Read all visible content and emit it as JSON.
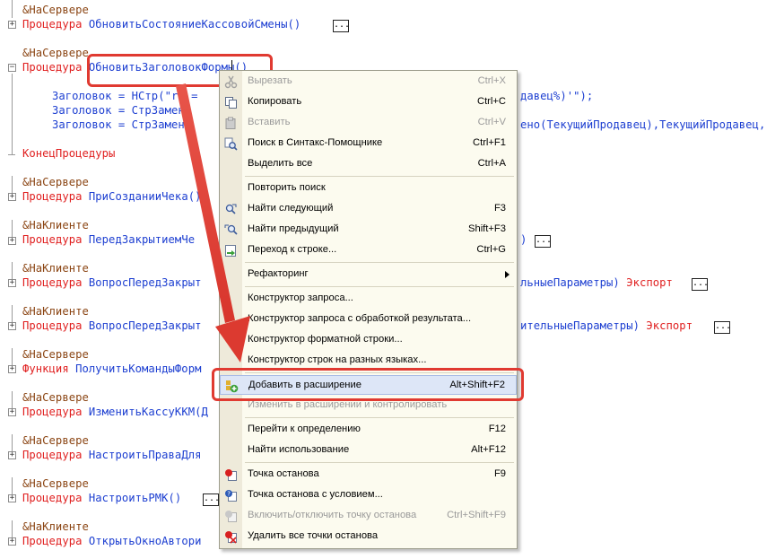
{
  "code": {
    "lines": [
      {
        "key": "l1",
        "dir": "&НаСервере"
      },
      {
        "key": "l2",
        "kw": "Процедура",
        "id": "ОбновитьСостояниеКассовойСмены()"
      },
      {
        "key": "l3",
        "dir": "&НаСервере"
      },
      {
        "key": "l4",
        "kw": "Процедура",
        "id": "ОбновитьЗаголовокФормы()"
      },
      {
        "key": "l5a",
        "text": "Заголовок = НСтр(\"ru ="
      },
      {
        "key": "l5b",
        "text": "давец%)'\");"
      },
      {
        "key": "l6a",
        "text": "Заголовок = СтрЗамени"
      },
      {
        "key": "l7a",
        "text": "Заголовок = СтрЗамени"
      },
      {
        "key": "l7b",
        "text": "ено(ТекущийПродавец),ТекущийПродавец,"
      },
      {
        "key": "l8",
        "kw": "КонецПроцедуры"
      },
      {
        "key": "l9",
        "dir": "&НаСервере"
      },
      {
        "key": "l10",
        "kw": "Процедура",
        "id": "ПриСозданииЧека()"
      },
      {
        "key": "l11",
        "dir": "&НаКлиенте"
      },
      {
        "key": "l12",
        "kw": "Процедура",
        "id": "ПередЗакрытиемЧе"
      },
      {
        "key": "l12b",
        "text": ")"
      },
      {
        "key": "l13",
        "dir": "&НаКлиенте"
      },
      {
        "key": "l14",
        "kw": "Процедура",
        "id": "ВопросПередЗакрыт"
      },
      {
        "key": "l14b",
        "text": "льныеПараметры)",
        "kw2": "Экспорт"
      },
      {
        "key": "l15",
        "dir": "&НаКлиенте"
      },
      {
        "key": "l16",
        "kw": "Процедура",
        "id": "ВопросПередЗакрыт"
      },
      {
        "key": "l16b",
        "text": "ительныеПараметры)",
        "kw2": "Экспорт"
      },
      {
        "key": "l17",
        "dir": "&НаСервере"
      },
      {
        "key": "l18",
        "kw": "Функция",
        "id": "ПолучитьКомандыФорм"
      },
      {
        "key": "l19",
        "dir": "&НаСервере"
      },
      {
        "key": "l20",
        "kw": "Процедура",
        "id": "ИзменитьКассуККМ(Д"
      },
      {
        "key": "l21",
        "dir": "&НаСервере"
      },
      {
        "key": "l22",
        "kw": "Процедура",
        "id": "НастроитьПраваДля"
      },
      {
        "key": "l23",
        "dir": "&НаСервере"
      },
      {
        "key": "l24",
        "kw": "Процедура",
        "id": "НастроитьРМК()"
      },
      {
        "key": "l25",
        "dir": "&НаКлиенте"
      },
      {
        "key": "l26",
        "kw": "Процедура",
        "id": "ОткрытьОкноАвтори"
      }
    ],
    "ellipsis": "..."
  },
  "menu": {
    "items": [
      {
        "label": "Вырезать",
        "shortcut": "Ctrl+X",
        "disabled": true,
        "icon": "scissors-icon"
      },
      {
        "label": "Копировать",
        "shortcut": "Ctrl+C",
        "disabled": false,
        "icon": "copy-icon"
      },
      {
        "label": "Вставить",
        "shortcut": "Ctrl+V",
        "disabled": true,
        "icon": "paste-icon"
      },
      {
        "label": "Поиск в Синтакс-Помощнике",
        "shortcut": "Ctrl+F1",
        "disabled": false,
        "icon": "syntax-search-icon"
      },
      {
        "label": "Выделить все",
        "shortcut": "Ctrl+A",
        "disabled": false,
        "icon": ""
      },
      {
        "label": "Повторить поиск",
        "shortcut": "",
        "disabled": false,
        "icon": ""
      },
      {
        "label": "Найти следующий",
        "shortcut": "F3",
        "disabled": false,
        "icon": "find-next-icon"
      },
      {
        "label": "Найти предыдущий",
        "shortcut": "Shift+F3",
        "disabled": false,
        "icon": "find-previous-icon"
      },
      {
        "label": "Переход к строке...",
        "shortcut": "Ctrl+G",
        "disabled": false,
        "icon": "goto-line-icon"
      },
      {
        "label": "Рефакторинг",
        "shortcut": "",
        "disabled": false,
        "icon": ""
      },
      {
        "label": "Конструктор запроса...",
        "shortcut": "",
        "disabled": false,
        "icon": ""
      },
      {
        "label": "Конструктор запроса с обработкой результата...",
        "shortcut": "",
        "disabled": false,
        "icon": ""
      },
      {
        "label": "Конструктор форматной строки...",
        "shortcut": "",
        "disabled": false,
        "icon": ""
      },
      {
        "label": "Конструктор строк на разных языках...",
        "shortcut": "",
        "disabled": false,
        "icon": ""
      },
      {
        "label": "Добавить в расширение",
        "shortcut": "Alt+Shift+F2",
        "disabled": false,
        "icon": "add-to-extension-icon"
      },
      {
        "label": "Изменить в расширении и контролировать",
        "shortcut": "",
        "disabled": true,
        "icon": ""
      },
      {
        "label": "Перейти к определению",
        "shortcut": "F12",
        "disabled": false,
        "icon": ""
      },
      {
        "label": "Найти использование",
        "shortcut": "Alt+F12",
        "disabled": false,
        "icon": ""
      },
      {
        "label": "Точка останова",
        "shortcut": "F9",
        "disabled": false,
        "icon": "breakpoint-icon"
      },
      {
        "label": "Точка останова с условием...",
        "shortcut": "",
        "disabled": false,
        "icon": "conditional-breakpoint-icon"
      },
      {
        "label": "Включить/отключить точку останова",
        "shortcut": "Ctrl+Shift+F9",
        "disabled": true,
        "icon": "toggle-breakpoint-icon"
      },
      {
        "label": "Удалить все точки останова",
        "shortcut": "",
        "disabled": false,
        "icon": "delete-breakpoints-icon"
      }
    ]
  },
  "colors": {
    "highlight_border": "#e03a31",
    "keyword": "#e02020",
    "identifier": "#1d3fd1",
    "directive": "#8b4513"
  }
}
